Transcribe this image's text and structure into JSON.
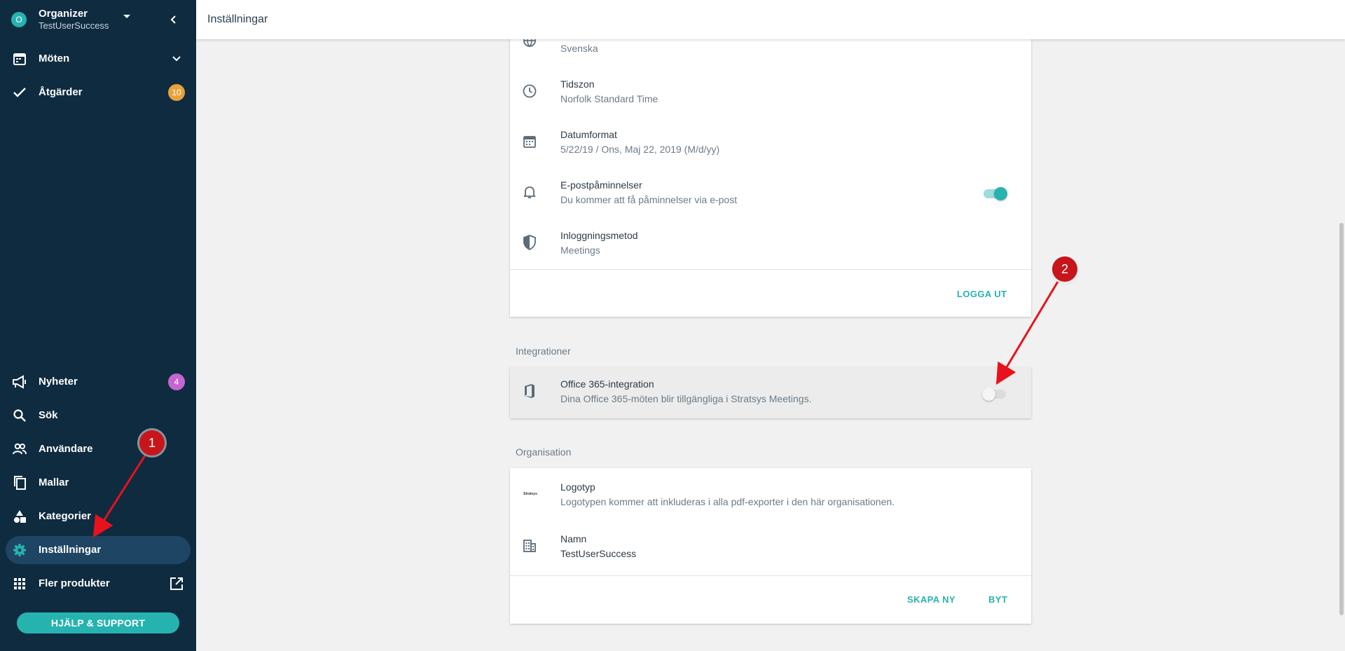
{
  "sidebar": {
    "org": {
      "avatar": "O",
      "name": "Organizer",
      "sub": "TestUserSuccess"
    },
    "items": [
      {
        "label": "Möten",
        "icon": "calendar-icon"
      },
      {
        "label": "Åtgärder",
        "icon": "check-icon",
        "badge": "10",
        "badge_color": "#e8a23a"
      },
      {
        "label": "Nyheter",
        "icon": "megaphone-icon",
        "badge": "4",
        "badge_color": "#c566d0"
      },
      {
        "label": "Sök",
        "icon": "search-icon"
      },
      {
        "label": "Användare",
        "icon": "users-icon"
      },
      {
        "label": "Mallar",
        "icon": "copy-icon"
      },
      {
        "label": "Kategorier",
        "icon": "shapes-icon"
      },
      {
        "label": "Inställningar",
        "icon": "gear-icon",
        "active": true
      },
      {
        "label": "Fler produkter",
        "icon": "apps-grid-icon"
      }
    ],
    "help_button": "HJÄLP & SUPPORT"
  },
  "topbar": {
    "title": "Inställningar"
  },
  "user_settings": {
    "rows": [
      {
        "title": "",
        "value": "Svenska",
        "icon": "globe-icon"
      },
      {
        "title": "Tidszon",
        "value": "Norfolk Standard Time",
        "icon": "clock-icon"
      },
      {
        "title": "Datumformat",
        "value": "5/22/19 / Ons, Maj 22, 2019 (M/d/yy)",
        "icon": "calendar-icon"
      },
      {
        "title": "E-postpåminnelser",
        "value": "Du kommer att få påminnelser via e-post",
        "icon": "bell-icon",
        "toggle": true
      },
      {
        "title": "Inloggningsmetod",
        "value": "Meetings",
        "icon": "shield-icon"
      }
    ],
    "logout_button": "LOGGA UT"
  },
  "integrations": {
    "label": "Integrationer",
    "office365": {
      "title": "Office 365-integration",
      "value": "Dina Office 365-möten blir tillgängliga i Stratsys Meetings.",
      "icon": "office-icon",
      "toggle": false
    }
  },
  "organisation": {
    "label": "Organisation",
    "logo": {
      "title": "Logotyp",
      "value": "Logotypen kommer att inkluderas i alla pdf-exporter i den här organisationen.",
      "logo_text": "Stratsys"
    },
    "name": {
      "title": "Namn",
      "value": "TestUserSuccess",
      "icon": "building-icon"
    },
    "create_button": "SKAPA NY",
    "switch_button": "BYT"
  },
  "annotations": {
    "marker1": "1",
    "marker2": "2"
  },
  "colors": {
    "sidebar": "#0f2b40",
    "accent": "#26b3b0",
    "active": "#1e4564",
    "marker": "#c8151b"
  }
}
